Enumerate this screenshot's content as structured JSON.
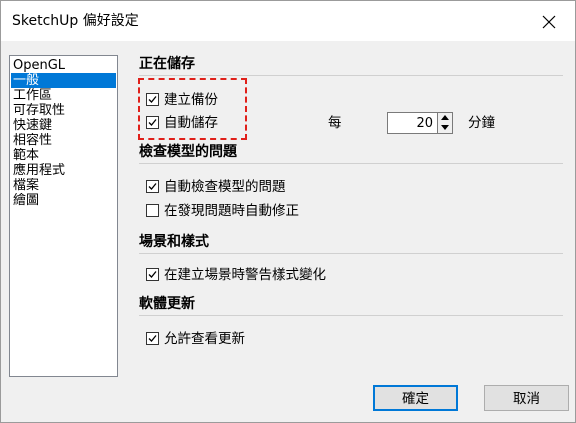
{
  "window": {
    "title": "SketchUp 偏好設定"
  },
  "sidebar": {
    "items": [
      {
        "label": "OpenGL",
        "selected": false
      },
      {
        "label": "一般",
        "selected": true
      },
      {
        "label": "工作區",
        "selected": false
      },
      {
        "label": "可存取性",
        "selected": false
      },
      {
        "label": "快速鍵",
        "selected": false
      },
      {
        "label": "相容性",
        "selected": false
      },
      {
        "label": "範本",
        "selected": false
      },
      {
        "label": "應用程式",
        "selected": false
      },
      {
        "label": "檔案",
        "selected": false
      },
      {
        "label": "繪圖",
        "selected": false
      }
    ]
  },
  "sections": {
    "saving": {
      "title": "正在儲存",
      "create_backup": {
        "label": "建立備份",
        "checked": true
      },
      "auto_save": {
        "label": "自動儲存",
        "checked": true
      },
      "every_label": "每",
      "minutes_value": "20",
      "minutes_unit": "分鐘"
    },
    "check_model": {
      "title": "檢查模型的問題",
      "auto_check": {
        "label": "自動檢查模型的問題",
        "checked": true
      },
      "auto_fix": {
        "label": "在發現問題時自動修正",
        "checked": false
      }
    },
    "scenes": {
      "title": "場景和樣式",
      "warn_style": {
        "label": "在建立場景時警告樣式變化",
        "checked": true
      }
    },
    "updates": {
      "title": "軟體更新",
      "allow_check": {
        "label": "允許查看更新",
        "checked": true
      }
    }
  },
  "buttons": {
    "ok": "確定",
    "cancel": "取消"
  },
  "colors": {
    "selection": "#0078d7",
    "highlight": "#e0201a",
    "dialog_bg": "#f0f0f0"
  }
}
